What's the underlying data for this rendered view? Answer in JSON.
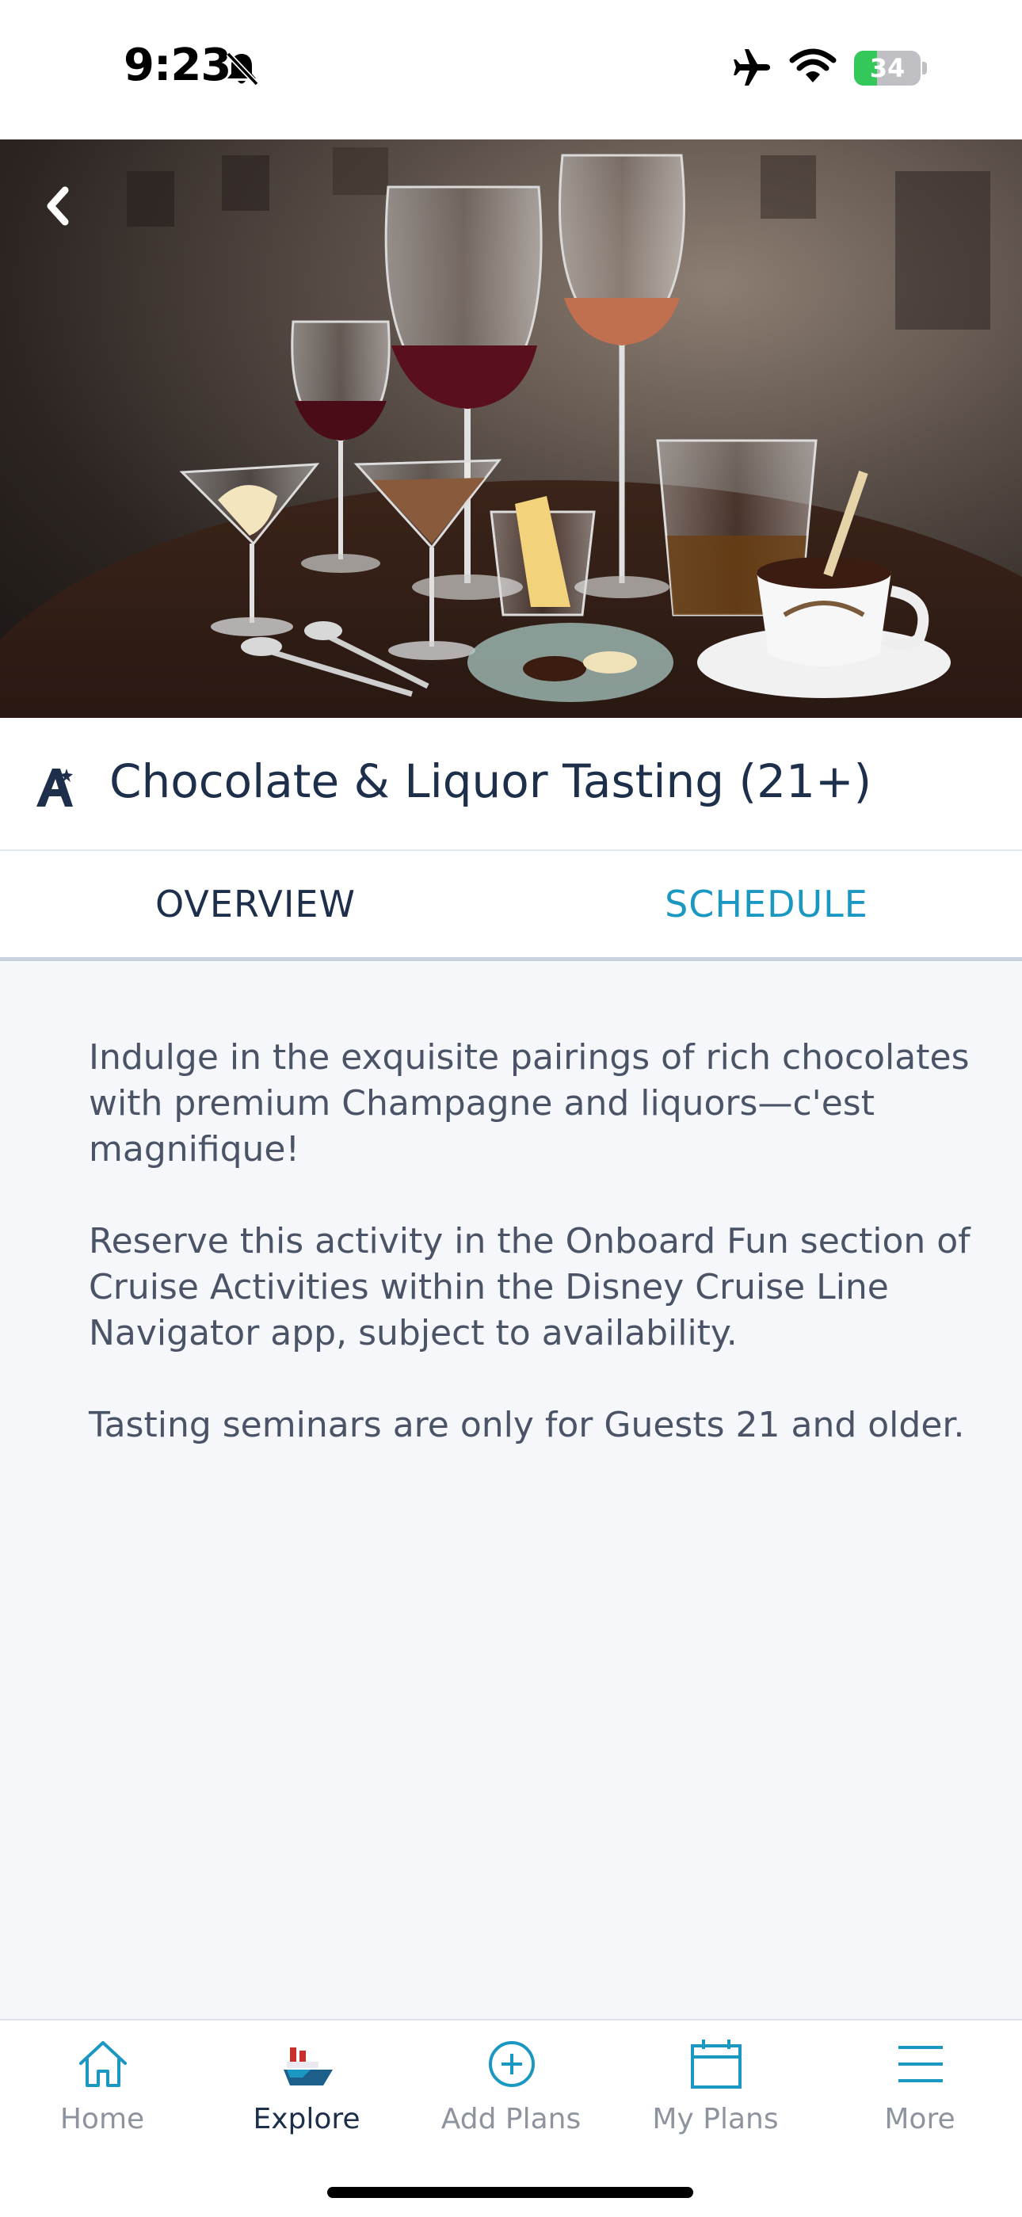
{
  "status_bar": {
    "time": "9:23",
    "battery_level": "34",
    "battery_fraction": 0.34,
    "icons": [
      "bell-slash-icon",
      "airplane-icon",
      "wifi-icon",
      "battery-icon"
    ]
  },
  "header": {
    "back_icon": "chevron-left-icon",
    "title": "Chocolate & Liquor Tasting (21+)",
    "title_icon": "activity-star-icon"
  },
  "tabs": [
    {
      "label": "OVERVIEW",
      "selected": true
    },
    {
      "label": "SCHEDULE",
      "selected": false
    }
  ],
  "description": [
    "Indulge in the exquisite pairings of rich chocolates with premium Champagne and liquors—c'est magnifique!",
    "Reserve this activity in the Onboard Fun section of Cruise Activities within the Disney Cruise Line Navigator app, subject to availability.",
    "Tasting seminars are only for Guests 21 and older."
  ],
  "tab_bar": {
    "items": [
      {
        "label": "Home",
        "icon": "home-icon",
        "active": false
      },
      {
        "label": "Explore",
        "icon": "ship-icon",
        "active": true
      },
      {
        "label": "Add Plans",
        "icon": "plus-circle-icon",
        "active": false
      },
      {
        "label": "My Plans",
        "icon": "calendar-icon",
        "active": false
      },
      {
        "label": "More",
        "icon": "menu-icon",
        "active": false
      }
    ]
  },
  "colors": {
    "accent": "#1b98c2",
    "navy": "#1d2f4a",
    "background": "#f5f7fb",
    "inactive": "#8e949e"
  }
}
